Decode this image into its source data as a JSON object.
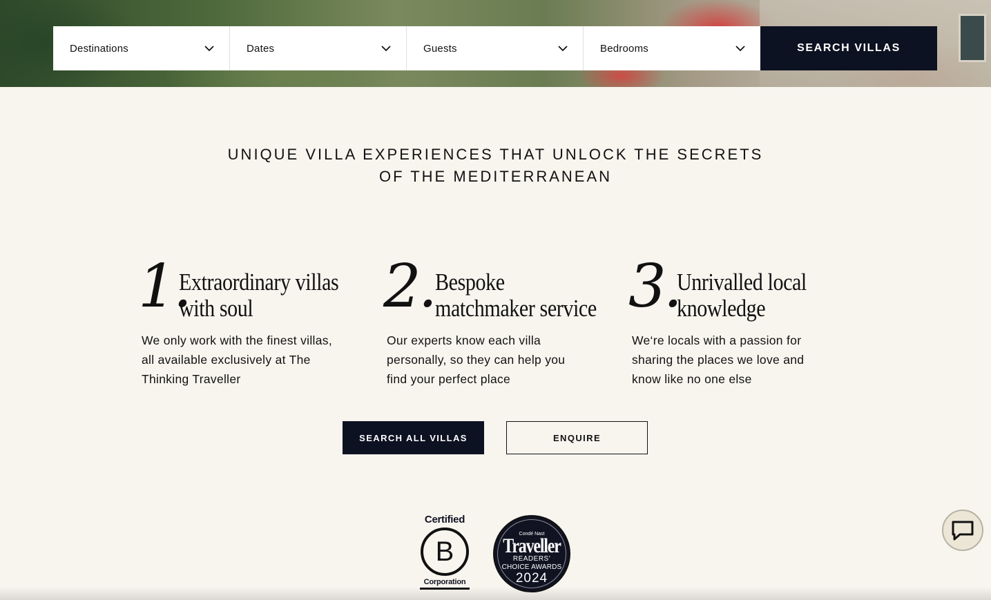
{
  "search": {
    "fields": [
      {
        "label": "Destinations"
      },
      {
        "label": "Dates"
      },
      {
        "label": "Guests"
      },
      {
        "label": "Bedrooms"
      }
    ],
    "button_label": "SEARCH VILLAS"
  },
  "headline": {
    "line1": "UNIQUE VILLA EXPERIENCES THAT UNLOCK THE SECRETS",
    "line2": "OF THE MEDITERRANEAN"
  },
  "features": [
    {
      "number": "1.",
      "title_line1": "Extraordinary villas",
      "title_line2": "with soul",
      "desc_line1": "We only work with the finest villas,",
      "desc_line2": "all available exclusively at The",
      "desc_line3": "Thinking Traveller"
    },
    {
      "number": "2.",
      "title_line1": "Bespoke",
      "title_line2": "matchmaker service",
      "desc_line1": "Our experts know each villa",
      "desc_line2": "personally, so they can help you",
      "desc_line3": "find your perfect place"
    },
    {
      "number": "3.",
      "title_line1": "Unrivalled local",
      "title_line2": "knowledge",
      "desc_line1": "We‘re locals with a passion for",
      "desc_line2": "sharing the places we love and",
      "desc_line3": "know like no one else"
    }
  ],
  "cta": {
    "primary": "SEARCH ALL VILLAS",
    "secondary": "ENQUIRE"
  },
  "badges": {
    "bcorp": {
      "top": "Certified",
      "letter": "B",
      "bottom": "Corporation"
    },
    "traveller": {
      "small": "Condé Nast",
      "brand": "Traveller",
      "line1": "READERS'",
      "line2": "CHOICE AWARDS",
      "year": "2024"
    }
  },
  "icons": {
    "chevron": "chevron-down-icon",
    "chat": "chat-bubble-icon"
  },
  "colors": {
    "background": "#f8f5ef",
    "navy": "#0d1222",
    "white": "#ffffff"
  }
}
